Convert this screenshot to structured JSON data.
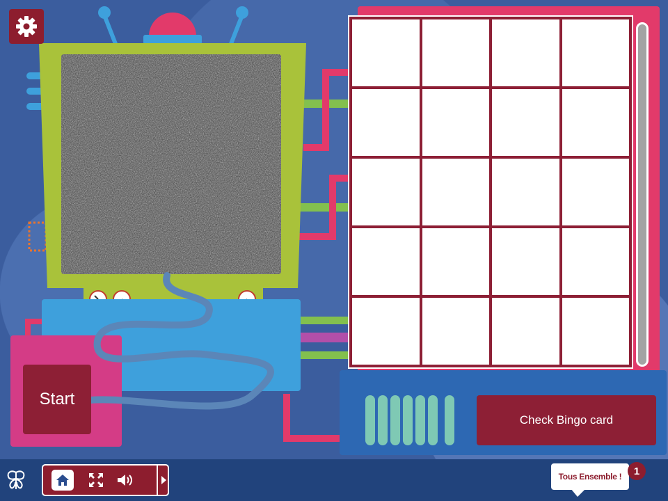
{
  "game": {
    "start_label": "Start",
    "check_label": "Check Bingo card",
    "bingo_cells": [
      "",
      "",
      "",
      "",
      "",
      "",
      "",
      "",
      "",
      "",
      "",
      "",
      "",
      "",
      "",
      "",
      "",
      "",
      "",
      ""
    ]
  },
  "bottom_bar": {
    "brand_tag": "Tous Ensemble !",
    "brand_badge": "1"
  },
  "icons": {
    "settings": "gear-icon",
    "home": "home-icon",
    "fullscreen": "fullscreen-icon",
    "sound": "speaker-icon",
    "next": "triangle-right-icon",
    "logo": "butterfly-logo-icon"
  },
  "colors": {
    "background": "#3b5d9e",
    "tv_frame": "#a9c23a",
    "bingo_frame": "#e23a6a",
    "button": "#8d1f35",
    "accent_blue": "#3ea0dc",
    "start_box": "#d43c86"
  }
}
